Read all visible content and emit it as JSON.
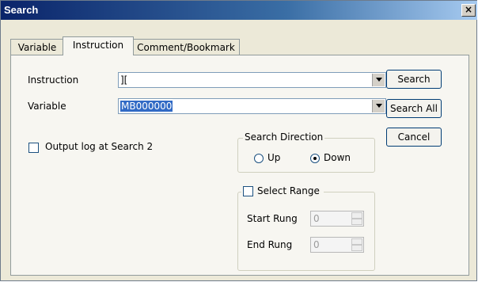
{
  "dialog": {
    "title": "Search",
    "close_glyph": "×"
  },
  "tabs": [
    {
      "label": "Variable",
      "active": false
    },
    {
      "label": "Instruction",
      "active": true
    },
    {
      "label": "Comment/Bookmark",
      "active": false
    }
  ],
  "instruction_field": {
    "label": "Instruction",
    "value": "]["
  },
  "variable_field": {
    "label": "Variable",
    "value": "MB000000"
  },
  "buttons": {
    "search": "Search",
    "search_all": "Search All",
    "cancel": "Cancel"
  },
  "output_log": {
    "label": "Output log at Search 2",
    "checked": false
  },
  "search_direction": {
    "title": "Search Direction",
    "up_label": "Up",
    "down_label": "Down",
    "selected": "Down"
  },
  "select_range": {
    "label": "Select Range",
    "checked": false,
    "start_label": "Start Rung",
    "start_value": "0",
    "end_label": "End Rung",
    "end_value": "0"
  },
  "icons": {
    "dropdown": "chevron-down-icon",
    "spin_up": "spin-up-icon",
    "spin_down": "spin-down-icon",
    "close": "close-icon"
  }
}
